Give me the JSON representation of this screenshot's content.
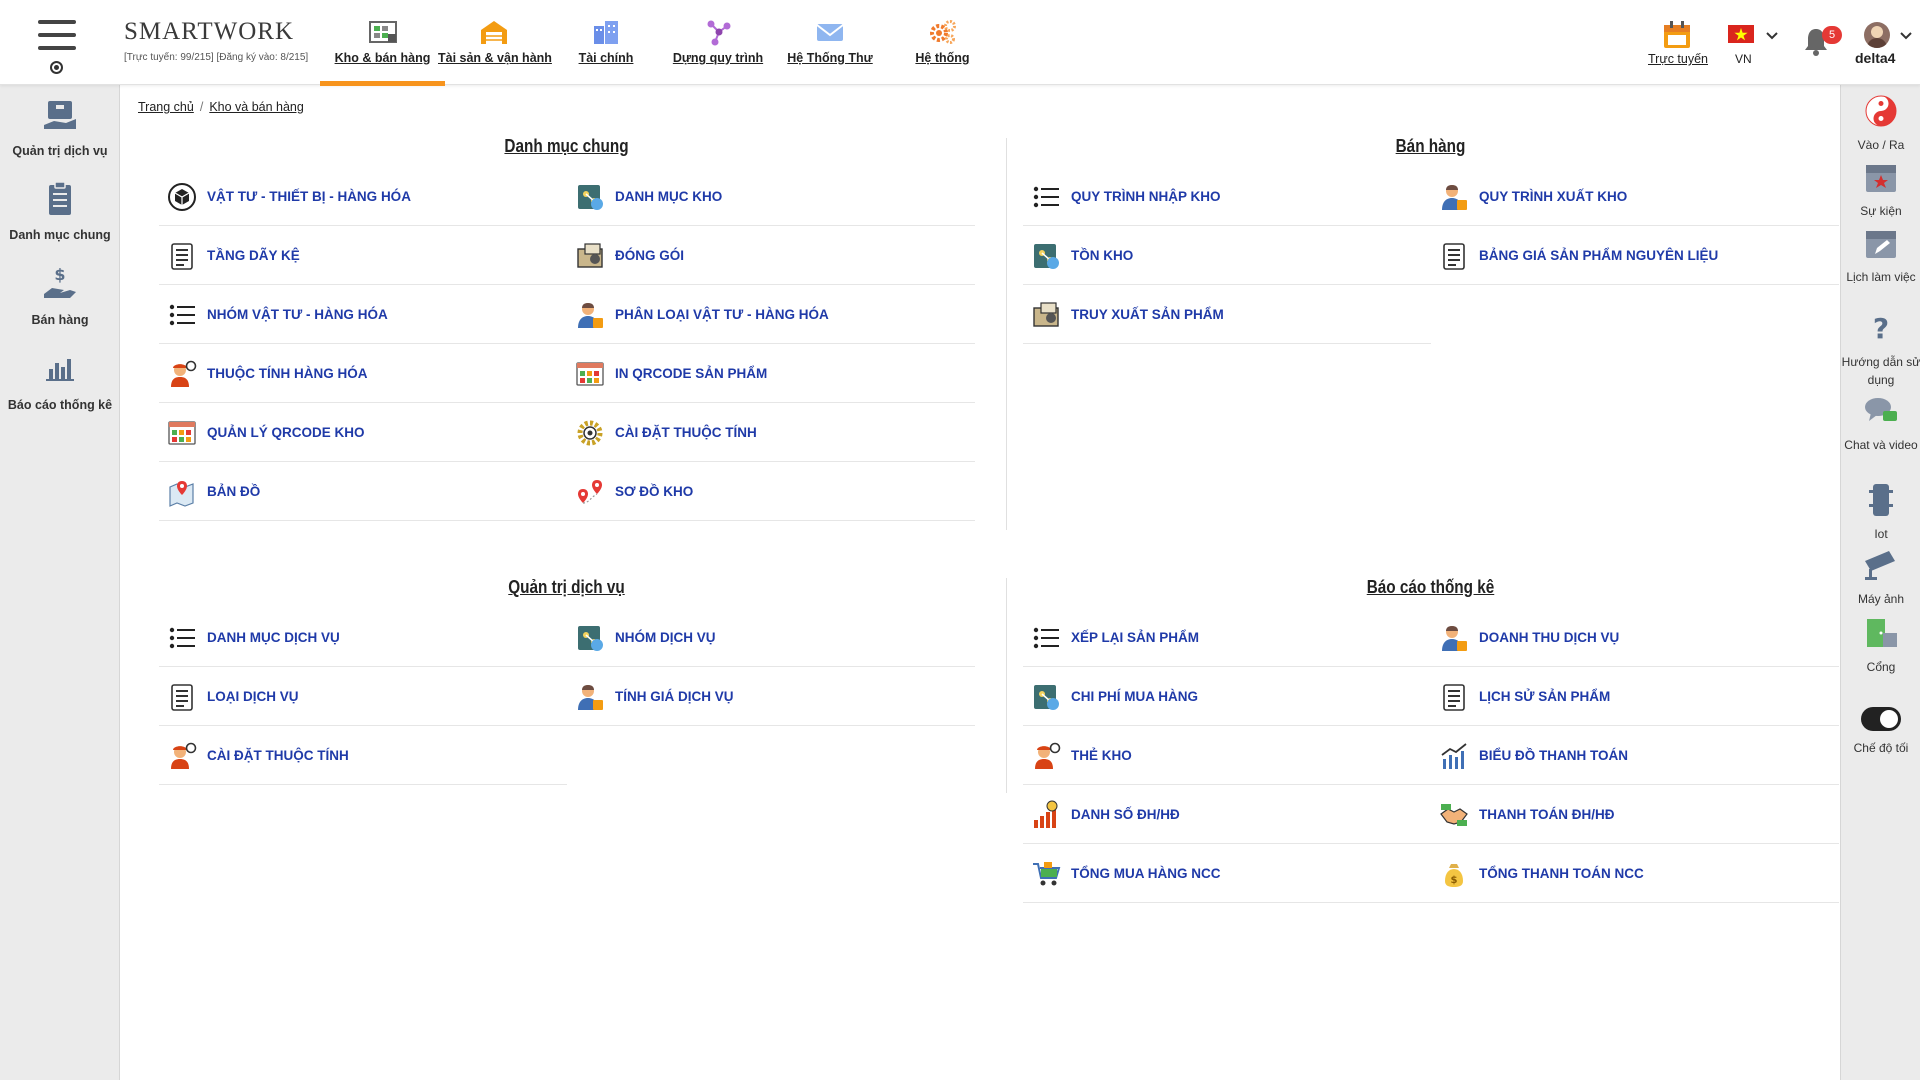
{
  "brand": {
    "name": "SMARTWORK",
    "stats": "[Trực tuyến: 99/215] [Đăng ký vào: 8/215]"
  },
  "nav_tabs": [
    {
      "label": "Kho & bán hàng",
      "icon": "warehouse-icon",
      "active": true
    },
    {
      "label": "Tài sản & vận hành",
      "icon": "garage-icon",
      "active": false
    },
    {
      "label": "Tài chính",
      "icon": "buildings-icon",
      "active": false
    },
    {
      "label": "Dựng quy trình",
      "icon": "workflow-icon",
      "active": false
    },
    {
      "label": "Hệ Thống Thư",
      "icon": "mail-icon",
      "active": false
    },
    {
      "label": "Hệ thống",
      "icon": "gears-icon",
      "active": false
    }
  ],
  "header_right": {
    "online_label": "Trực tuyến",
    "lang_label": "VN",
    "notif_count": "5",
    "username": "delta4"
  },
  "sidebar_left": [
    {
      "label": "Quản trị dịch vụ",
      "icon": "service-box-icon"
    },
    {
      "label": "Danh mục chung",
      "icon": "clipboard-icon"
    },
    {
      "label": "Bán hàng",
      "icon": "hand-dollar-icon"
    },
    {
      "label": "Báo cáo thống kê",
      "icon": "bar-chart-icon"
    }
  ],
  "sidebar_right": [
    {
      "label": "Vào / Ra",
      "icon": "yin-yang-icon"
    },
    {
      "label": "Sự kiện",
      "icon": "calendar-star-icon"
    },
    {
      "label": "Lịch làm việc",
      "icon": "calendar-edit-icon"
    },
    {
      "label": "Hướng dẫn sử dụng",
      "icon": "question-icon"
    },
    {
      "label": "Chat và video",
      "icon": "chat-icon"
    },
    {
      "label": "Iot",
      "icon": "device-icon"
    },
    {
      "label": "Máy ảnh",
      "icon": "camera-icon"
    },
    {
      "label": "Cổng",
      "icon": "gate-icon"
    },
    {
      "label": "Chế độ tối",
      "icon": "toggle-icon"
    }
  ],
  "breadcrumb": {
    "home": "Trang chủ",
    "current": "Kho và bán hàng"
  },
  "sections": {
    "danh_muc_chung": {
      "title": "Danh mục chung",
      "items": [
        {
          "label": "VẬT TƯ - THIẾT BỊ - HÀNG HÓA",
          "icon": "box-icon"
        },
        {
          "label": "DANH MỤC KHO",
          "icon": "network-icon"
        },
        {
          "label": "TẦNG DÃY KỆ",
          "icon": "document-icon"
        },
        {
          "label": "ĐÓNG GÓI",
          "icon": "package-icon"
        },
        {
          "label": "NHÓM VẬT TƯ - HÀNG HÓA",
          "icon": "list-icon"
        },
        {
          "label": "PHÂN LOẠI VẬT TƯ - HÀNG HÓA",
          "icon": "person-icon"
        },
        {
          "label": "THUỘC TÍNH HÀNG HÓA",
          "icon": "worker-icon"
        },
        {
          "label": "IN QRCODE SẢN PHẨM",
          "icon": "qr-grid-icon"
        },
        {
          "label": "QUẢN LÝ QRCODE KHO",
          "icon": "qr-grid-icon"
        },
        {
          "label": "CÀI ĐẶT THUỘC TÍNH",
          "icon": "gear-icon"
        },
        {
          "label": "BẢN ĐỒ",
          "icon": "map-icon"
        },
        {
          "label": "SƠ ĐỒ KHO",
          "icon": "map-pin-icon"
        }
      ]
    },
    "ban_hang": {
      "title": "Bán hàng",
      "items": [
        {
          "label": "QUY TRÌNH NHẬP KHO",
          "icon": "list-icon"
        },
        {
          "label": "QUY TRÌNH XUẤT KHO",
          "icon": "person-icon"
        },
        {
          "label": "TỒN KHO",
          "icon": "network-icon"
        },
        {
          "label": "BẢNG GIÁ SẢN PHẨM NGUYÊN LIỆU",
          "icon": "document-icon"
        },
        {
          "label": "TRUY XUẤT SẢN PHẨM",
          "icon": "package-icon"
        }
      ]
    },
    "quan_tri_dich_vu": {
      "title": "Quản trị dịch vụ",
      "items": [
        {
          "label": "DANH MỤC DỊCH VỤ",
          "icon": "list-icon"
        },
        {
          "label": "NHÓM DỊCH VỤ",
          "icon": "network-icon"
        },
        {
          "label": "LOẠI DỊCH VỤ",
          "icon": "document-icon"
        },
        {
          "label": "TÍNH GIÁ DỊCH VỤ",
          "icon": "person-icon"
        },
        {
          "label": "CÀI ĐẶT THUỘC TÍNH",
          "icon": "worker-icon"
        }
      ]
    },
    "bao_cao_thong_ke": {
      "title": "Báo cáo thống kê",
      "items": [
        {
          "label": "XẾP LẠI SẢN PHẨM",
          "icon": "list-icon"
        },
        {
          "label": "DOANH THU DỊCH VỤ",
          "icon": "person-icon"
        },
        {
          "label": "CHI PHÍ MUA HÀNG",
          "icon": "network-icon"
        },
        {
          "label": "LỊCH SỬ SẢN PHẨM",
          "icon": "document-icon"
        },
        {
          "label": "THẺ KHO",
          "icon": "worker-icon"
        },
        {
          "label": "BIỂU ĐỒ THANH TOÁN",
          "icon": "line-chart-icon"
        },
        {
          "label": "DANH SỐ ĐH/HĐ",
          "icon": "bars-coin-icon"
        },
        {
          "label": "THANH TOÁN ĐH/HĐ",
          "icon": "handshake-icon"
        },
        {
          "label": "TỔNG MUA HÀNG NCC",
          "icon": "cart-icon"
        },
        {
          "label": "TỔNG THANH TOÁN NCC",
          "icon": "money-bag-icon"
        }
      ]
    }
  },
  "colors": {
    "accent": "#f7941d",
    "link": "#1f3aa8",
    "badge": "#e53935"
  }
}
